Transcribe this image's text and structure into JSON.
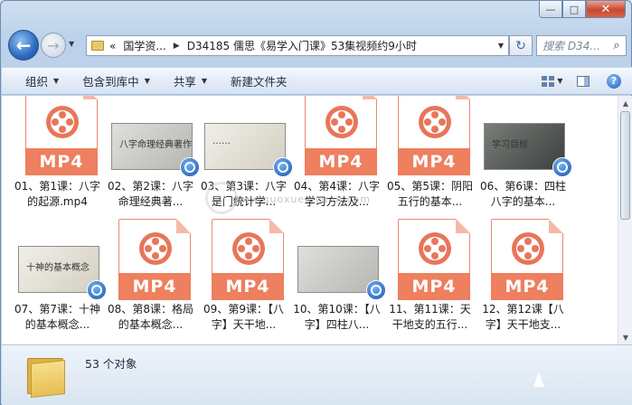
{
  "window": {
    "minimize_glyph": "—",
    "maximize_glyph": "□",
    "close_glyph": "✕"
  },
  "nav": {
    "back_glyph": "←",
    "forward_glyph": "→",
    "drop_glyph": "▼"
  },
  "address": {
    "chevron": "«",
    "segments": [
      "国学资...",
      "D34185 儒思《易学入门课》53集视频约9小时"
    ],
    "sep": "▶"
  },
  "search": {
    "placeholder": "搜索 D34...",
    "icon": "search-icon"
  },
  "toolbar": {
    "items": [
      "组织",
      "包含到库中",
      "共享",
      "新建文件夹"
    ]
  },
  "files": [
    {
      "name": "01、第1课：八字的起源.mp4",
      "kind": "mp4"
    },
    {
      "name": "02、第2课：八字命理经典著...",
      "kind": "video",
      "thumb_text": "八字命理经典著作"
    },
    {
      "name": "03、第3课：八字是门统计学...",
      "kind": "video",
      "thumb_text": "……"
    },
    {
      "name": "04、第4课：八字学习方法及...",
      "kind": "mp4"
    },
    {
      "name": "05、第5课：阴阳五行的基本...",
      "kind": "mp4"
    },
    {
      "name": "06、第6课：四柱八字的基本...",
      "kind": "video",
      "thumb_text": "学习目标"
    },
    {
      "name": "07、第7课：十神的基本概念...",
      "kind": "video",
      "thumb_text": "十神的基本概念"
    },
    {
      "name": "08、第8课：格局的基本概念...",
      "kind": "mp4"
    },
    {
      "name": "09、第9课：【八字】天干地...",
      "kind": "mp4"
    },
    {
      "name": "10、第10课：【八字】四柱八...",
      "kind": "video",
      "thumb_text": ""
    },
    {
      "name": "11、第11课：天干地支的五行...",
      "kind": "mp4"
    },
    {
      "name": "12、第12课【八字】天干地支...",
      "kind": "mp4"
    }
  ],
  "mp4_label": "MP4",
  "watermark": "www.guoxueziyuan.com",
  "status": {
    "count": "53 个对象"
  }
}
